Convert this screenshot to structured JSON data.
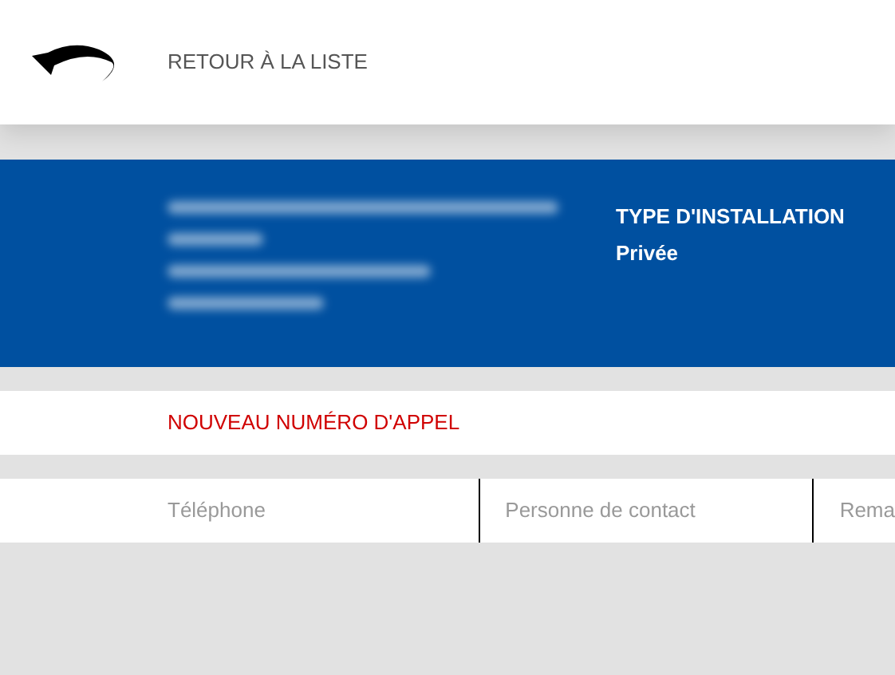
{
  "header": {
    "back_link": "RETOUR À LA LISTE"
  },
  "installation": {
    "label": "TYPE D'INSTALLATION",
    "value": "Privée"
  },
  "new_number_link": "NOUVEAU NUMÉRO D'APPEL",
  "table": {
    "columns": [
      "Téléphone",
      "Personne de contact",
      "Rema"
    ]
  }
}
